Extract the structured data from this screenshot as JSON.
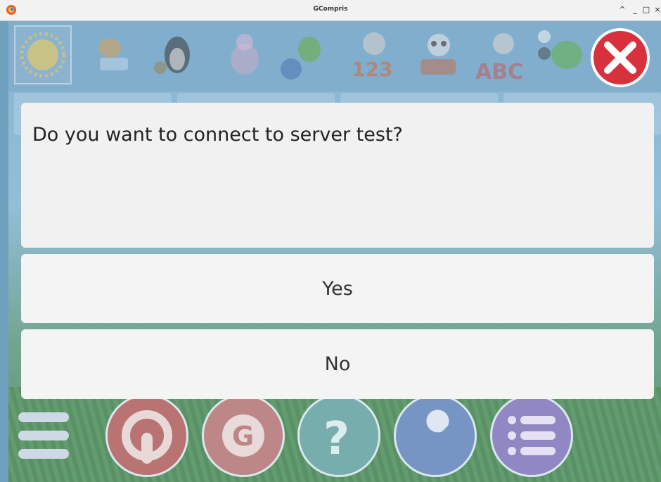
{
  "window": {
    "title": "GCompris",
    "controls": [
      "^",
      "_",
      "□",
      "×"
    ]
  },
  "dialog": {
    "question": "Do you want to connect to server test?",
    "yes_label": "Yes",
    "no_label": "No"
  },
  "icons": {
    "app": "gcompris-logo-icon",
    "close": "close-icon",
    "categories": [
      "favorite-sun-icon",
      "cat-computer-icon",
      "penguin-gears-icon",
      "sheep-science-icon",
      "dragon-ball-icon",
      "sheep-numbers-icon",
      "panda-puzzle-icon",
      "cow-letters-icon",
      "frog-strategy-icon"
    ],
    "bottom_bar": [
      "menu-icon",
      "exit-icon",
      "about-icon",
      "help-icon",
      "settings-icon",
      "activity-config-icon"
    ]
  },
  "colors": {
    "close_red": "#d9303e",
    "dialog_bg": "#f4f4f4",
    "exit_btn": "#b56b6b",
    "about_btn": "#b98080",
    "help_btn": "#6fa8a8",
    "settings_btn": "#6f8fbf",
    "config_btn": "#8a80c0"
  }
}
